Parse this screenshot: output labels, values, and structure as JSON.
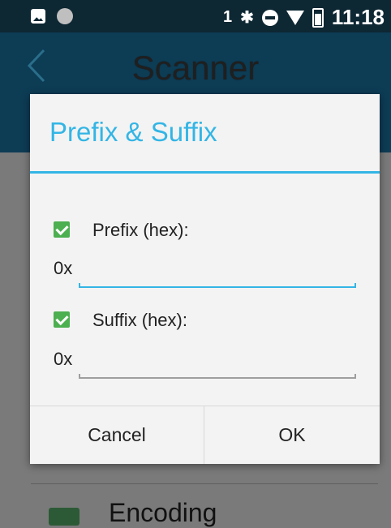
{
  "status_bar": {
    "sim_label": "1",
    "time": "11:18",
    "icons": [
      "gallery-icon",
      "record-dot-icon",
      "bluetooth-icon",
      "do-not-disturb-icon",
      "wifi-icon",
      "battery-icon"
    ]
  },
  "app_bar": {
    "title": "Scanner",
    "back_icon": "chevron-left-icon"
  },
  "background_list": {
    "item_label": "Encoding",
    "item_icon": "barcode-icon"
  },
  "dialog": {
    "title": "Prefix & Suffix",
    "prefix": {
      "label": "Prefix (hex):",
      "checked": true,
      "hex_prefix": "0x",
      "value": ""
    },
    "suffix": {
      "label": "Suffix (hex):",
      "checked": true,
      "hex_prefix": "0x",
      "value": ""
    },
    "cancel_label": "Cancel",
    "ok_label": "OK"
  },
  "colors": {
    "accent": "#33b5e5",
    "checkbox": "#4caf50",
    "status_bar_bg": "#0d2733",
    "app_bar_bg": "#0d3c55",
    "dialog_bg": "#f3f3f3",
    "scrim": "#7a7a7a"
  }
}
